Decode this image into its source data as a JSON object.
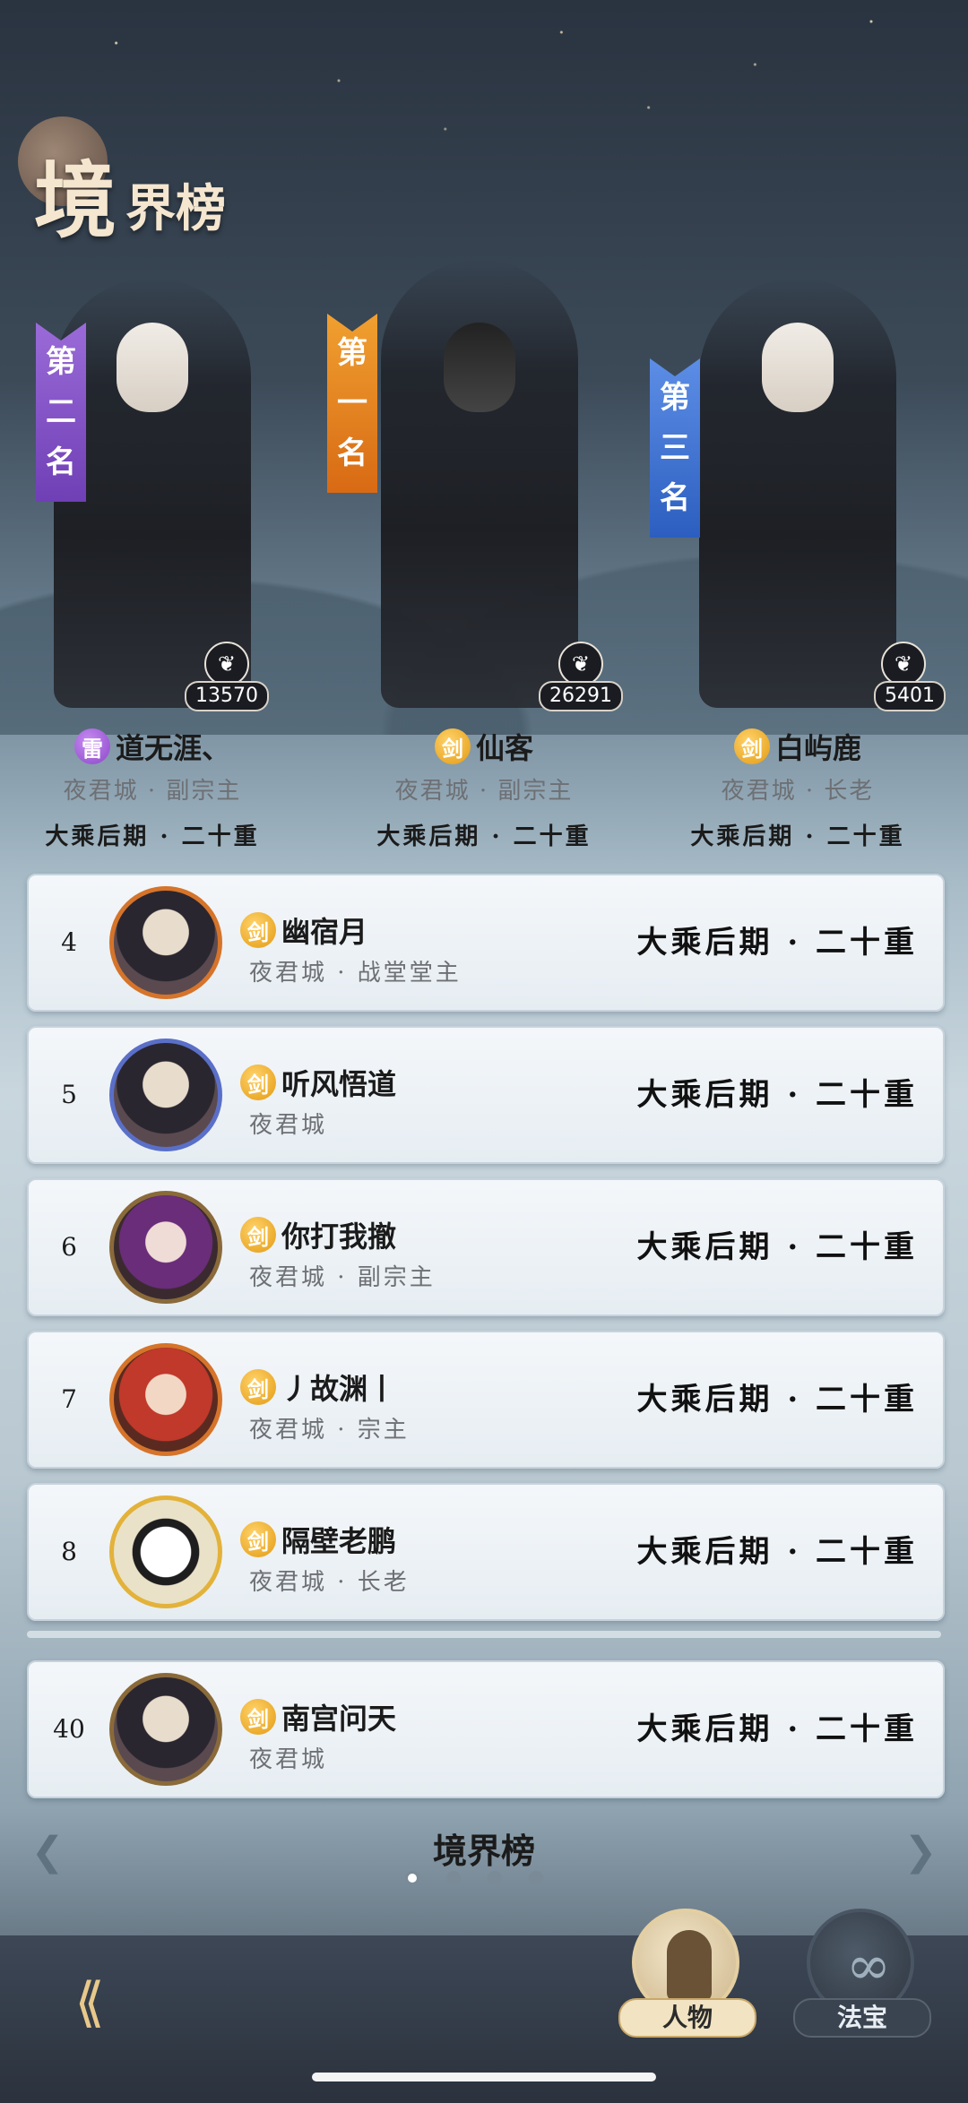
{
  "page_title": {
    "big": "境",
    "small": "界榜"
  },
  "podium": [
    {
      "rank_label": "第二名",
      "rank_chars": [
        "第",
        "二",
        "名"
      ],
      "likes": "13570",
      "badge": "雷",
      "name": "道无涯、",
      "sect": "夜君城 · 副宗主",
      "realm": "大乘后期 · 二十重"
    },
    {
      "rank_label": "第一名",
      "rank_chars": [
        "第",
        "一",
        "名"
      ],
      "likes": "26291",
      "badge": "剑",
      "name": "仙客",
      "sect": "夜君城 · 副宗主",
      "realm": "大乘后期 · 二十重"
    },
    {
      "rank_label": "第三名",
      "rank_chars": [
        "第",
        "三",
        "名"
      ],
      "likes": "5401",
      "badge": "剑",
      "name": "白屿鹿",
      "sect": "夜君城 · 长老",
      "realm": "大乘后期 · 二十重"
    }
  ],
  "list": [
    {
      "rank": "4",
      "badge": "剑",
      "name": "幽宿月",
      "sect": "夜君城 · 战堂堂主",
      "realm": "大乘后期 · 二十重"
    },
    {
      "rank": "5",
      "badge": "剑",
      "name": "听风悟道",
      "sect": "夜君城",
      "realm": "大乘后期 · 二十重"
    },
    {
      "rank": "6",
      "badge": "剑",
      "name": "你打我撤",
      "sect": "夜君城 · 副宗主",
      "realm": "大乘后期 · 二十重"
    },
    {
      "rank": "7",
      "badge": "剑",
      "name": "丿故渊丨",
      "sect": "夜君城 · 宗主",
      "realm": "大乘后期 · 二十重"
    },
    {
      "rank": "8",
      "badge": "剑",
      "name": "隔壁老鹏",
      "sect": "夜君城 · 长老",
      "realm": "大乘后期 · 二十重"
    }
  ],
  "self_row": {
    "rank": "40",
    "badge": "剑",
    "name": "南宫问天",
    "sect": "夜君城",
    "realm": "大乘后期 · 二十重"
  },
  "bottom": {
    "title": "境界榜",
    "page_count": 4,
    "active_page": 1
  },
  "icons": {
    "back": "back-arrow-icon",
    "prev": "chevron-left-icon",
    "next": "chevron-right-icon",
    "like": "like-icon"
  },
  "tabs": {
    "people": "人物",
    "treasure": "法宝"
  },
  "colors": {
    "gold_badge": "#e39a12",
    "purple_badge": "#8a46c8",
    "rank1": "#d86a14",
    "rank2": "#6f3fb5",
    "rank3": "#2c5ec0"
  }
}
